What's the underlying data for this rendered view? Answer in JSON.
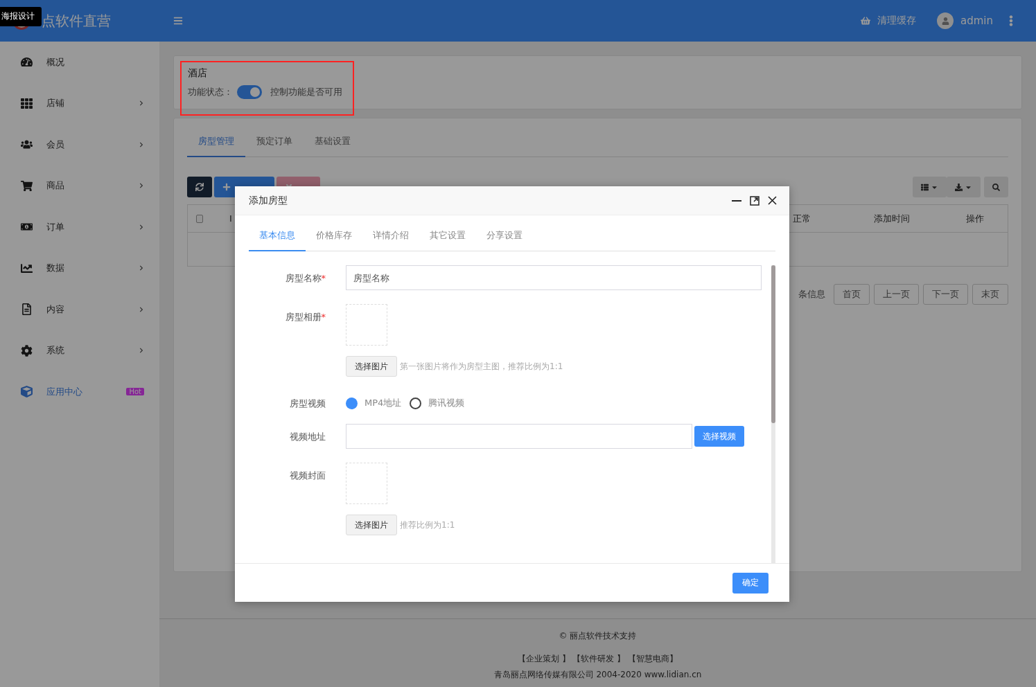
{
  "overlay_tooltip": "海报设计",
  "header": {
    "brand": "点软件直营",
    "clear_cache": "清理缓存",
    "user": "admin"
  },
  "sidebar": [
    {
      "label": "概况",
      "arrow": false,
      "selected": false
    },
    {
      "label": "店铺",
      "arrow": true,
      "selected": false
    },
    {
      "label": "会员",
      "arrow": true,
      "selected": false
    },
    {
      "label": "商品",
      "arrow": true,
      "selected": false
    },
    {
      "label": "订单",
      "arrow": true,
      "selected": false
    },
    {
      "label": "数据",
      "arrow": true,
      "selected": false
    },
    {
      "label": "内容",
      "arrow": true,
      "selected": false
    },
    {
      "label": "系统",
      "arrow": true,
      "selected": false
    },
    {
      "label": "应用中心",
      "arrow": false,
      "selected": true,
      "badge": "Hot"
    }
  ],
  "feature": {
    "title": "酒店",
    "status_label": "功能状态：",
    "enabled": true,
    "hint": "控制功能是否可用"
  },
  "tabs": [
    {
      "label": "房型管理",
      "selected": true
    },
    {
      "label": "预定订单",
      "selected": false
    },
    {
      "label": "基础设置",
      "selected": false
    }
  ],
  "table": {
    "columns": [
      "I",
      "正常",
      "添加时间",
      "操作"
    ],
    "checked": false
  },
  "pagination": {
    "info": "条信息",
    "buttons": [
      "首页",
      "上一页",
      "下一页",
      "末页"
    ]
  },
  "dialog": {
    "title": "添加房型",
    "tabs": [
      {
        "label": "基本信息",
        "selected": true
      },
      {
        "label": "价格库存",
        "selected": false
      },
      {
        "label": "详情介绍",
        "selected": false
      },
      {
        "label": "其它设置",
        "selected": false
      },
      {
        "label": "分享设置",
        "selected": false
      }
    ],
    "fields": [
      {
        "kind": "text",
        "label": "房型名称",
        "required_mark": "*",
        "placeholder": "房型名称"
      },
      {
        "kind": "image",
        "label": "房型相册",
        "required_mark": "*",
        "button": "选择图片",
        "hint": "第一张图片将作为房型主图，推荐比例为1:1"
      },
      {
        "kind": "radio",
        "label": "房型视频",
        "options": [
          {
            "label": "MP4地址",
            "selected": true
          },
          {
            "label": "腾讯视频",
            "selected": false
          }
        ]
      },
      {
        "kind": "url",
        "label": "视频地址",
        "button": "选择视频"
      },
      {
        "kind": "image",
        "label": "视频封面",
        "button": "选择图片",
        "hint": "推荐比例为1:1"
      }
    ],
    "confirm": "确定"
  },
  "footer": {
    "support": "© 丽点软件技术支持",
    "links": "【企业策划 】 【软件研发 】 【智慧电商】",
    "copyright": "青岛丽点网络传媒有限公司 2004-2020 www.lidian.cn"
  }
}
